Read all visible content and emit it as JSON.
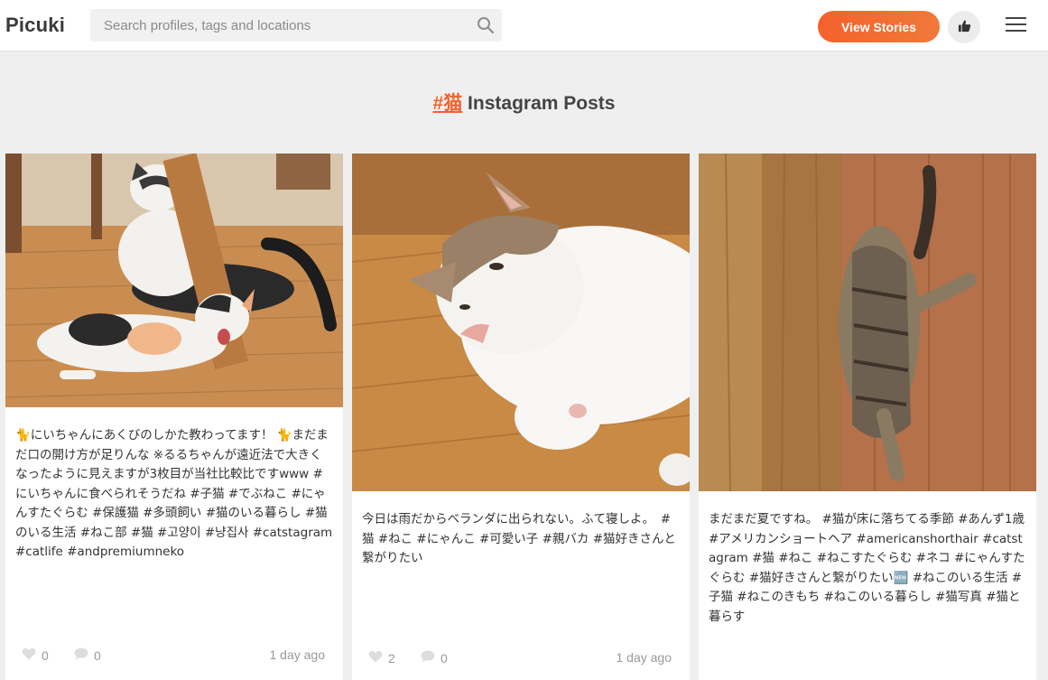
{
  "header": {
    "logo": "Picuki",
    "search_placeholder": "Search profiles, tags and locations",
    "stories_label": "View Stories"
  },
  "page": {
    "tag": "#猫",
    "title_suffix": " Instagram Posts"
  },
  "posts": [
    {
      "caption": "🐈にいちゃんにあくびのしかた教わってます！ 🐈まだまだ口の開け方が足りんな ※るるちゃんが遠近法で大きくなったように見えますが3枚目が当社比較比ですwww #にいちゃんに食べられそうだね #子猫 #でぶねこ #にゃんすたぐらむ #保護猫 #多頭飼い #猫のいる暮らし #猫のいる生活 #ねこ部 #猫 #고양이 #냥집사 #catstagram #catlife #andpremiumneko",
      "likes": "0",
      "comments": "0",
      "time": "1 day ago"
    },
    {
      "caption": "今日は雨だからベランダに出られない。ふて寝しよ。　#猫 #ねこ #にゃんこ #可愛い子 #親バカ #猫好きさんと繋がりたい",
      "likes": "2",
      "comments": "0",
      "time": "1 day ago"
    },
    {
      "caption": "まだまだ夏ですね。 #猫が床に落ちてる季節 #あんず1歳 #アメリカンショートヘア #americanshorthair #catstagram #猫 #ねこ #ねこすたぐらむ #ネコ #にゃんすたぐらむ #猫好きさんと繋がりたい🆕 #ねこのいる生活 #子猫 #ねこのきもち #ねこのいる暮らし #猫写真 #猫と暮らす",
      "likes": "",
      "comments": "",
      "time": ""
    }
  ],
  "colors": {
    "accent": "#f1622c",
    "background": "#efefef"
  }
}
